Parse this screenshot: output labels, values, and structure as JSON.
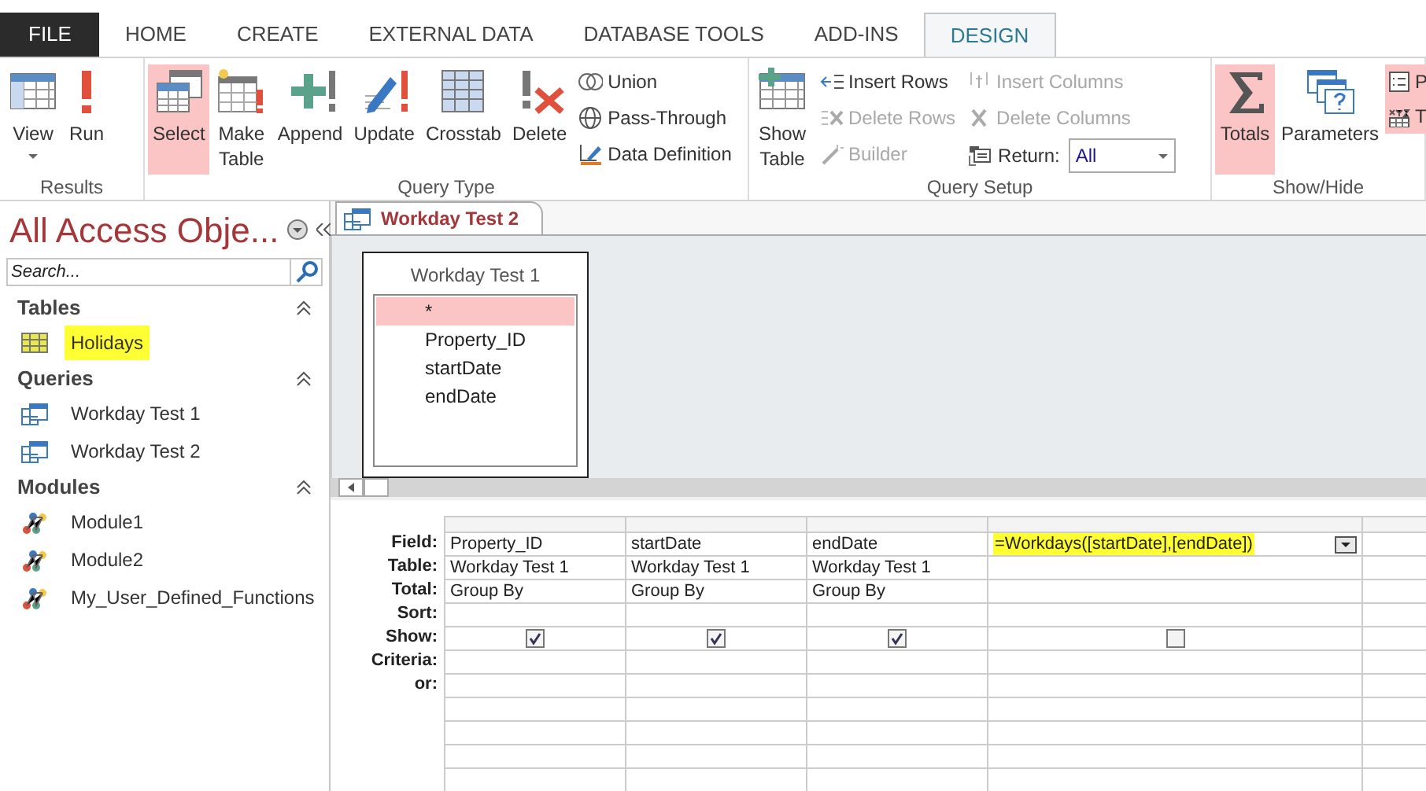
{
  "tabs": [
    {
      "label": "FILE",
      "kind": "file",
      "selected": false
    },
    {
      "label": "HOME",
      "kind": "tab",
      "selected": false
    },
    {
      "label": "CREATE",
      "kind": "tab",
      "selected": false
    },
    {
      "label": "EXTERNAL DATA",
      "kind": "tab",
      "selected": false
    },
    {
      "label": "DATABASE TOOLS",
      "kind": "tab",
      "selected": false
    },
    {
      "label": "ADD-INS",
      "kind": "tab",
      "selected": false
    },
    {
      "label": "DESIGN",
      "kind": "tab",
      "selected": true
    }
  ],
  "ribbon_groups": [
    {
      "label": "Results",
      "items": [
        {
          "kind": "large",
          "label": "View",
          "dropdown": true,
          "selected": false
        },
        {
          "kind": "large",
          "label": "Run",
          "dropdown": false,
          "selected": false
        }
      ]
    },
    {
      "label": "Query Type",
      "items": [
        {
          "kind": "large",
          "label": "Select",
          "dropdown": false,
          "selected": true
        },
        {
          "kind": "large",
          "label": "Make Table",
          "dropdown": false,
          "selected": false
        },
        {
          "kind": "large",
          "label": "Append",
          "dropdown": false,
          "selected": false
        },
        {
          "kind": "large",
          "label": "Update",
          "dropdown": false,
          "selected": false
        },
        {
          "kind": "large",
          "label": "Crosstab",
          "dropdown": false,
          "selected": false
        },
        {
          "kind": "large",
          "label": "Delete",
          "dropdown": false,
          "selected": false
        },
        {
          "kind": "stack",
          "items": [
            {
              "label": "Union",
              "disabled": false
            },
            {
              "label": "Pass-Through",
              "disabled": false
            },
            {
              "label": "Data Definition",
              "disabled": false
            }
          ]
        }
      ]
    },
    {
      "label": "Query Setup",
      "items": [
        {
          "kind": "large",
          "label": "Show Table",
          "dropdown": false,
          "selected": false
        },
        {
          "kind": "stack",
          "items": [
            {
              "label": "Insert Rows",
              "disabled": false
            },
            {
              "label": "Delete Rows",
              "disabled": true
            },
            {
              "label": "Builder",
              "disabled": true
            }
          ]
        },
        {
          "kind": "stack",
          "items": [
            {
              "label": "Insert Columns",
              "disabled": true
            },
            {
              "label": "Delete Columns",
              "disabled": true
            },
            {
              "label": "Return:",
              "value": "All"
            }
          ]
        }
      ]
    },
    {
      "label": "Show/Hide",
      "items": [
        {
          "kind": "large",
          "label": "Totals",
          "dropdown": false,
          "selected": true
        },
        {
          "kind": "large",
          "label": "Parameters",
          "dropdown": false,
          "selected": false
        },
        {
          "kind": "cutstack",
          "selected": true,
          "items": [
            {
              "label": "P"
            },
            {
              "label": "T"
            }
          ]
        }
      ]
    }
  ],
  "nav_pane": {
    "title": "All Access Obje...",
    "search": {
      "placeholder": "Search..."
    },
    "groups": [
      {
        "name": "Tables",
        "items": [
          {
            "kind": "table",
            "label": "Holidays",
            "highlighted": true
          }
        ]
      },
      {
        "name": "Queries",
        "items": [
          {
            "kind": "query",
            "label": "Workday Test 1",
            "highlighted": false
          },
          {
            "kind": "query",
            "label": "Workday Test 2",
            "highlighted": false
          }
        ]
      },
      {
        "name": "Modules",
        "items": [
          {
            "kind": "module",
            "label": "Module1",
            "highlighted": false
          },
          {
            "kind": "module",
            "label": "Module2",
            "highlighted": false
          },
          {
            "kind": "module",
            "label": "My_User_Defined_Functions",
            "highlighted": false
          }
        ]
      }
    ]
  },
  "document_tab": {
    "title": "Workday Test 2"
  },
  "field_list": {
    "title": "Workday Test 1",
    "fields": [
      {
        "label": "*",
        "selected": true
      },
      {
        "label": "Property_ID",
        "selected": false
      },
      {
        "label": "startDate",
        "selected": false
      },
      {
        "label": "endDate",
        "selected": false
      }
    ]
  },
  "design_grid": {
    "row_labels": [
      "Field:",
      "Table:",
      "Total:",
      "Sort:",
      "Show:",
      "Criteria:",
      "or:"
    ],
    "columns": [
      {
        "field": "Property_ID",
        "table": "Workday Test 1",
        "total": "Group By",
        "show": true,
        "highlighted": false,
        "dropdown": false
      },
      {
        "field": "startDate",
        "table": "Workday Test 1",
        "total": "Group By",
        "show": true,
        "highlighted": false,
        "dropdown": false
      },
      {
        "field": "endDate",
        "table": "Workday Test 1",
        "total": "Group By",
        "show": true,
        "highlighted": false,
        "dropdown": false
      },
      {
        "field": "=Workdays([startDate],[endDate])",
        "show": false,
        "highlighted": true,
        "dropdown": true
      }
    ]
  }
}
